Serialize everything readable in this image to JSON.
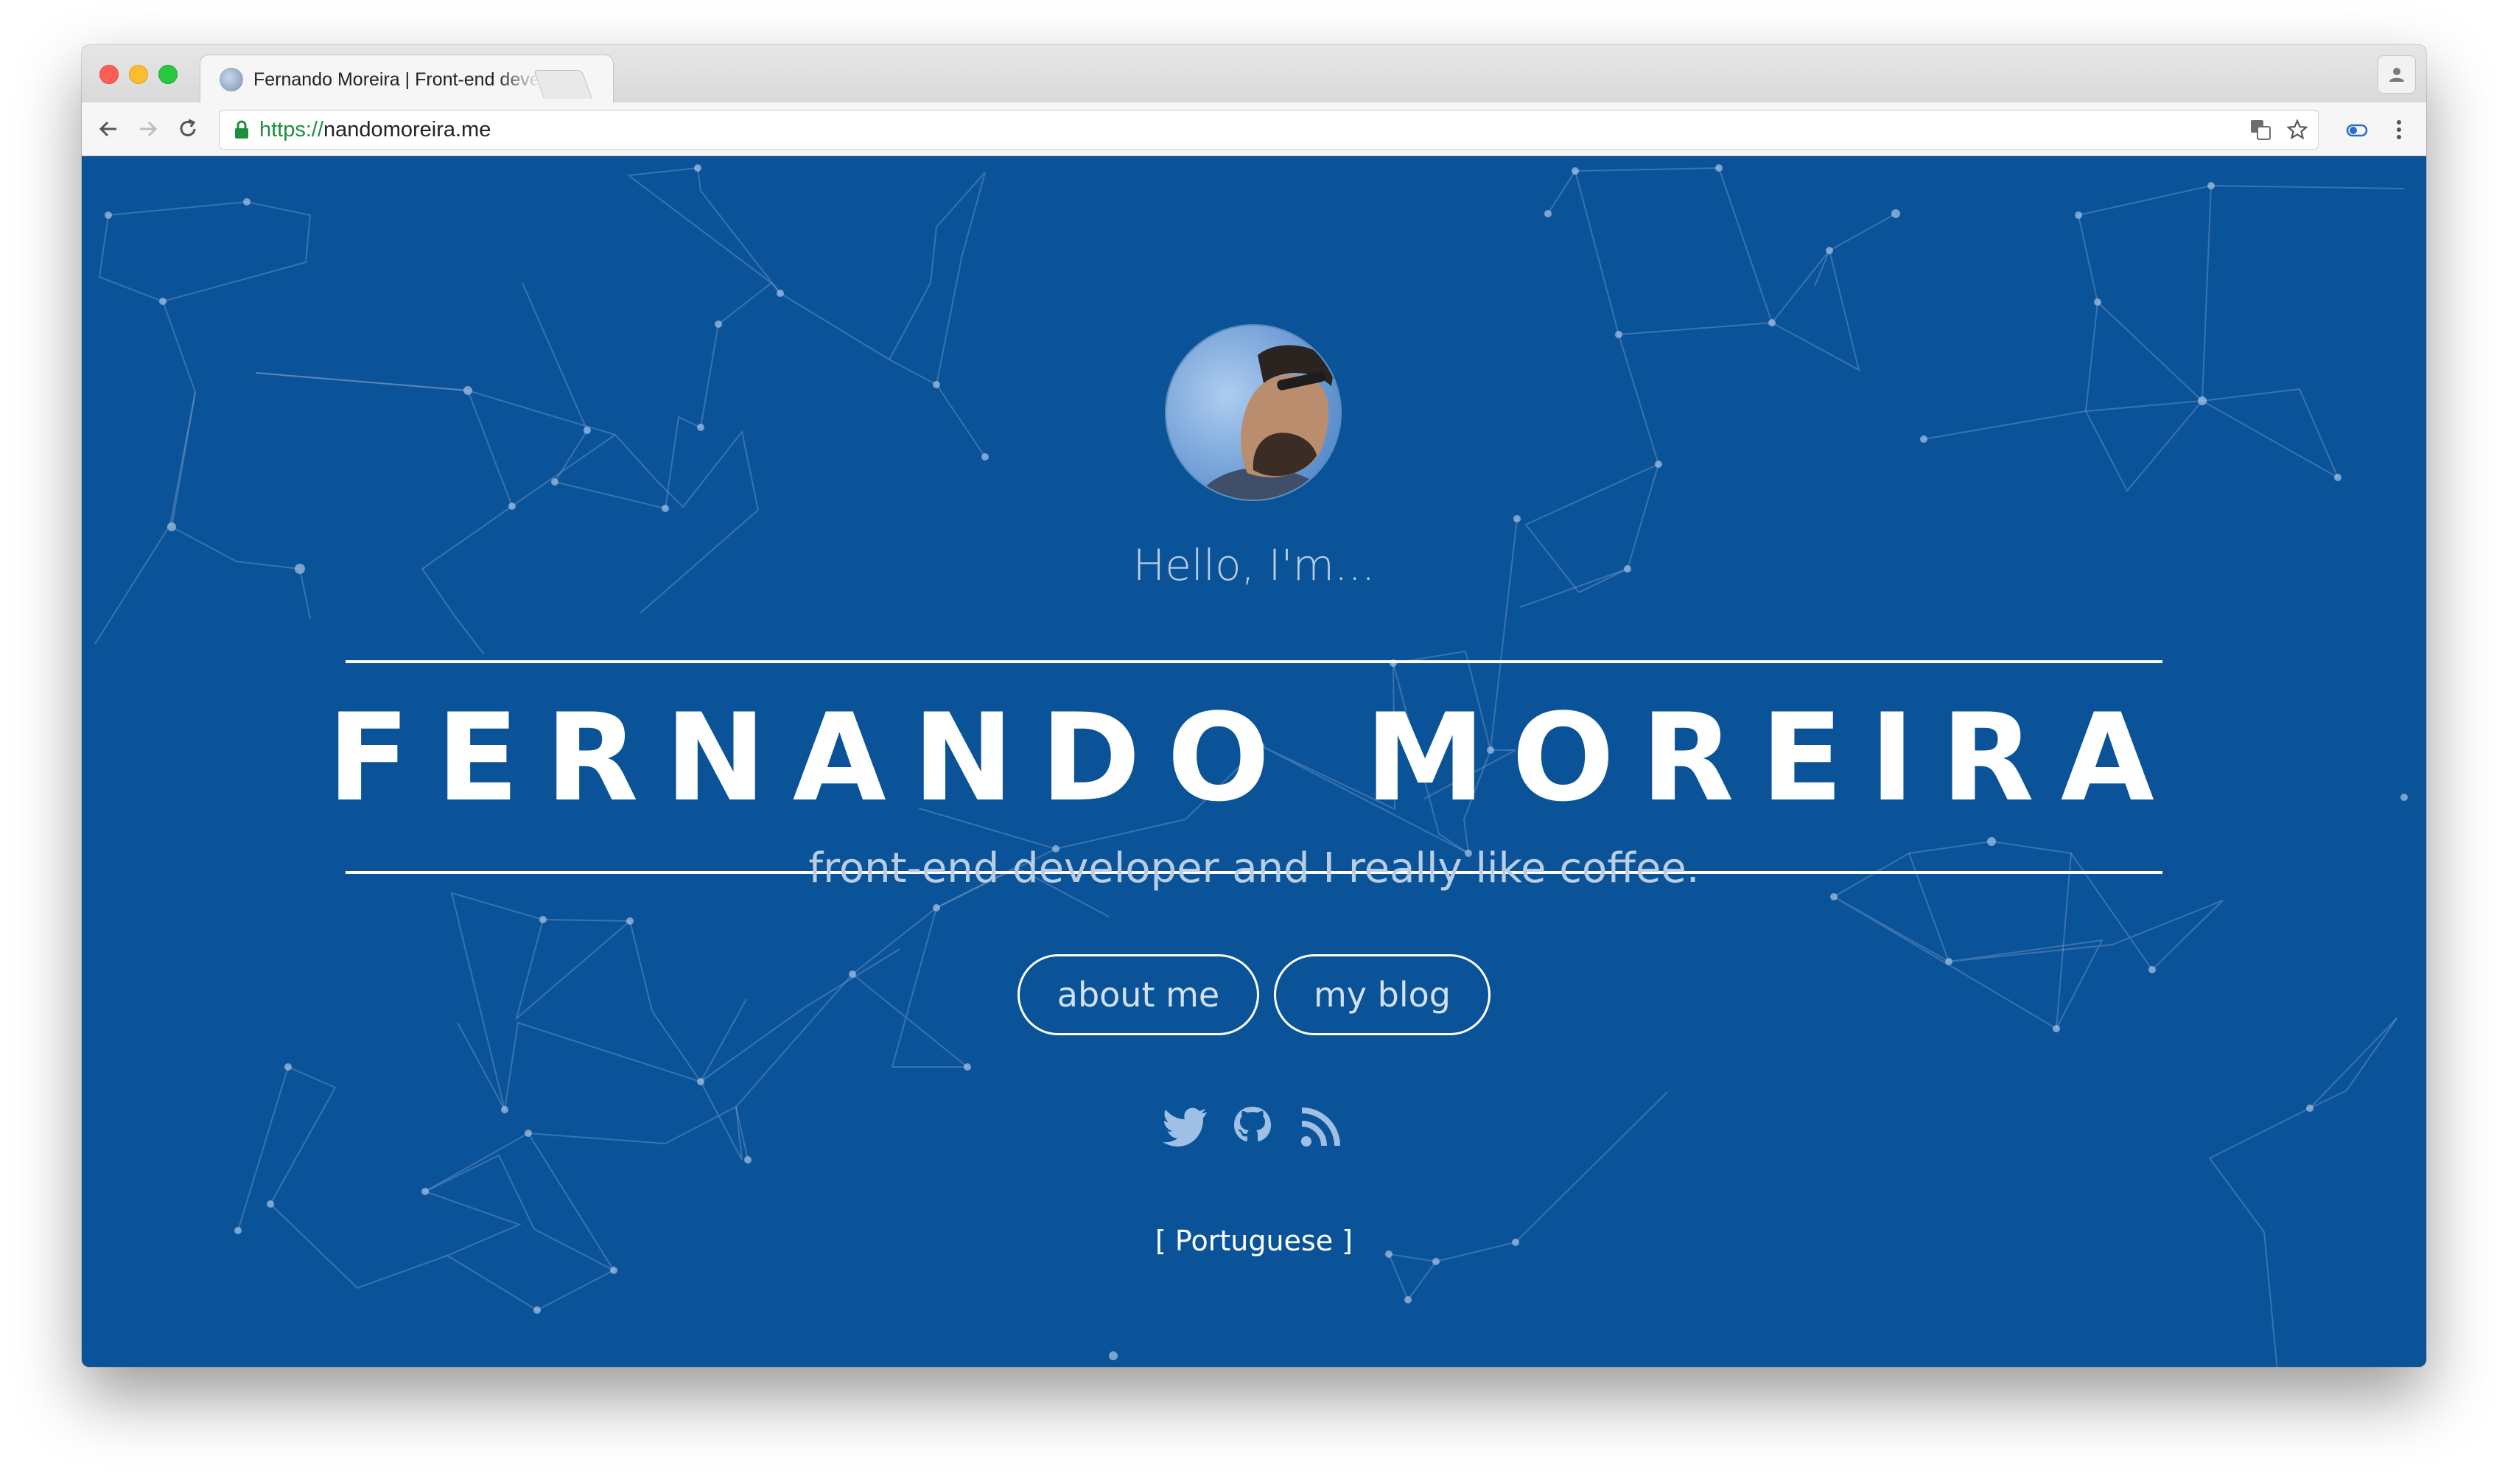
{
  "browser": {
    "tab_title": "Fernando Moreira | Front-end developer",
    "tab_close": "×",
    "url_scheme": "https://",
    "url_host": "nandomoreira.me"
  },
  "hero": {
    "greeting": "Hello, I'm...",
    "name": "FERNANDO MOREIRA",
    "tagline": "front-end developer and I really like coffee.",
    "buttons": [
      {
        "label": "about me"
      },
      {
        "label": "my blog"
      }
    ],
    "social_icons": [
      "twitter-icon",
      "github-icon",
      "rss-icon"
    ],
    "language_link": "[ Portuguese ]"
  },
  "colors": {
    "background": "#0b5398",
    "text_primary": "#ffffff",
    "text_muted": "#b9cde5"
  }
}
